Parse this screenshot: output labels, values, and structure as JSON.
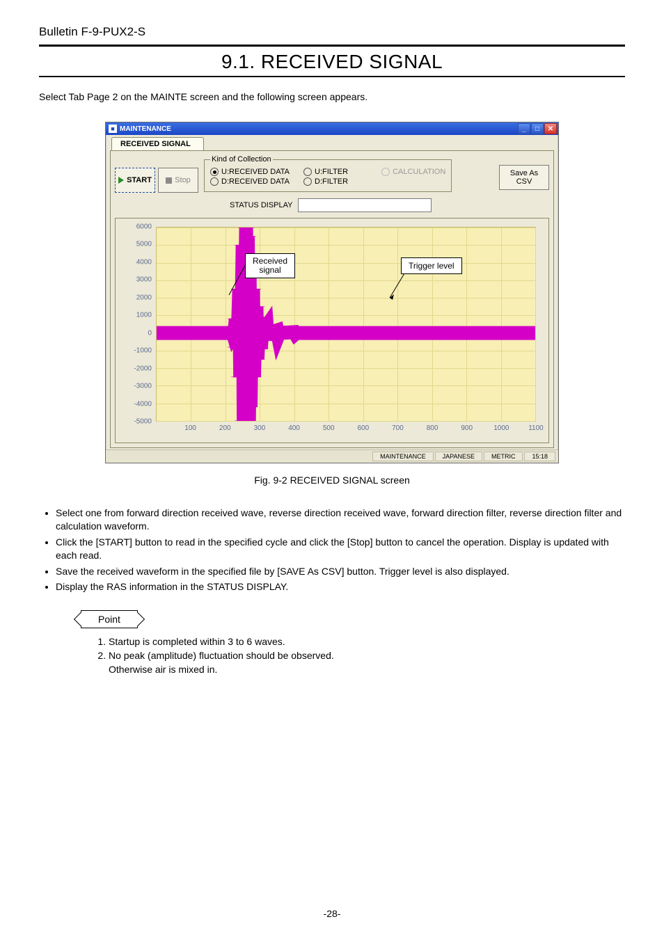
{
  "bulletin": "Bulletin F-9-PUX2-S",
  "section_title": "9.1. RECEIVED SIGNAL",
  "intro": "Select Tab Page 2 on the MAINTE screen and the following screen appears.",
  "window": {
    "title": "MAINTENANCE",
    "tab": "RECEIVED SIGNAL",
    "start_btn": "START",
    "stop_btn": "Stop",
    "kind_legend": "Kind of Collection",
    "radios": {
      "u_recv": "U:RECEIVED DATA",
      "d_recv": "D:RECEIVED DATA",
      "u_filter": "U:FILTER",
      "d_filter": "D:FILTER",
      "calc": "CALCULATION"
    },
    "save_as_1": "Save As",
    "save_as_2": "CSV",
    "status_label": "STATUS DISPLAY",
    "callout_recv_1": "Received",
    "callout_recv_2": "signal",
    "callout_trig": "Trigger level",
    "statusbar": {
      "maint": "MAINTENANCE",
      "lang": "JAPANESE",
      "unit": "METRIC",
      "time": "15:18"
    }
  },
  "fig_caption": "Fig. 9-2 RECEIVED SIGNAL screen",
  "bullets": [
    "Select one from forward direction received wave, reverse direction received wave, forward direction filter, reverse direction filter and calculation waveform.",
    "Click the [START] button to read in the specified cycle and click the [Stop] button to cancel the operation. Display is updated with each read.",
    "Save the received waveform in the specified file by [SAVE As CSV] button. Trigger level is also displayed.",
    "Display the RAS information in the STATUS DISPLAY."
  ],
  "point_label": "Point",
  "points": [
    "Startup is completed within 3 to 6 waves.",
    "No peak (amplitude) fluctuation should be observed.\nOtherwise air is mixed in."
  ],
  "page_number": "-28-",
  "chart_data": {
    "type": "line",
    "xlabel": "",
    "ylabel": "",
    "xlim": [
      0,
      1100
    ],
    "ylim": [
      -5000,
      6000
    ],
    "xticks": [
      100,
      200,
      300,
      400,
      500,
      600,
      700,
      800,
      900,
      1000,
      1100
    ],
    "yticks": [
      -5000,
      -4000,
      -3000,
      -2000,
      -1000,
      0,
      1000,
      2000,
      3000,
      4000,
      5000,
      6000
    ],
    "series": [
      {
        "name": "Received signal",
        "color": "#d400c8",
        "note": "Approximate amplitude envelope of ultrasonic burst — oscillates around 0 with peak amplitude near x≈260 then decays",
        "envelope": [
          {
            "x": 220,
            "amp": 100
          },
          {
            "x": 230,
            "amp": 800
          },
          {
            "x": 240,
            "amp": 2500
          },
          {
            "x": 250,
            "amp": 5000
          },
          {
            "x": 260,
            "amp": 6000
          },
          {
            "x": 265,
            "amp": 5500
          },
          {
            "x": 270,
            "amp": 4200
          },
          {
            "x": 280,
            "amp": 2500
          },
          {
            "x": 290,
            "amp": 1500
          },
          {
            "x": 300,
            "amp": 900
          },
          {
            "x": 320,
            "amp": 400
          },
          {
            "x": 350,
            "amp": 150
          },
          {
            "x": 400,
            "amp": 50
          },
          {
            "x": 500,
            "amp": 0
          }
        ]
      },
      {
        "name": "Trigger level",
        "color": "#d400c8",
        "note": "Horizontal threshold line pointed to by callout arrow, approx y = 0 baseline region"
      }
    ]
  }
}
